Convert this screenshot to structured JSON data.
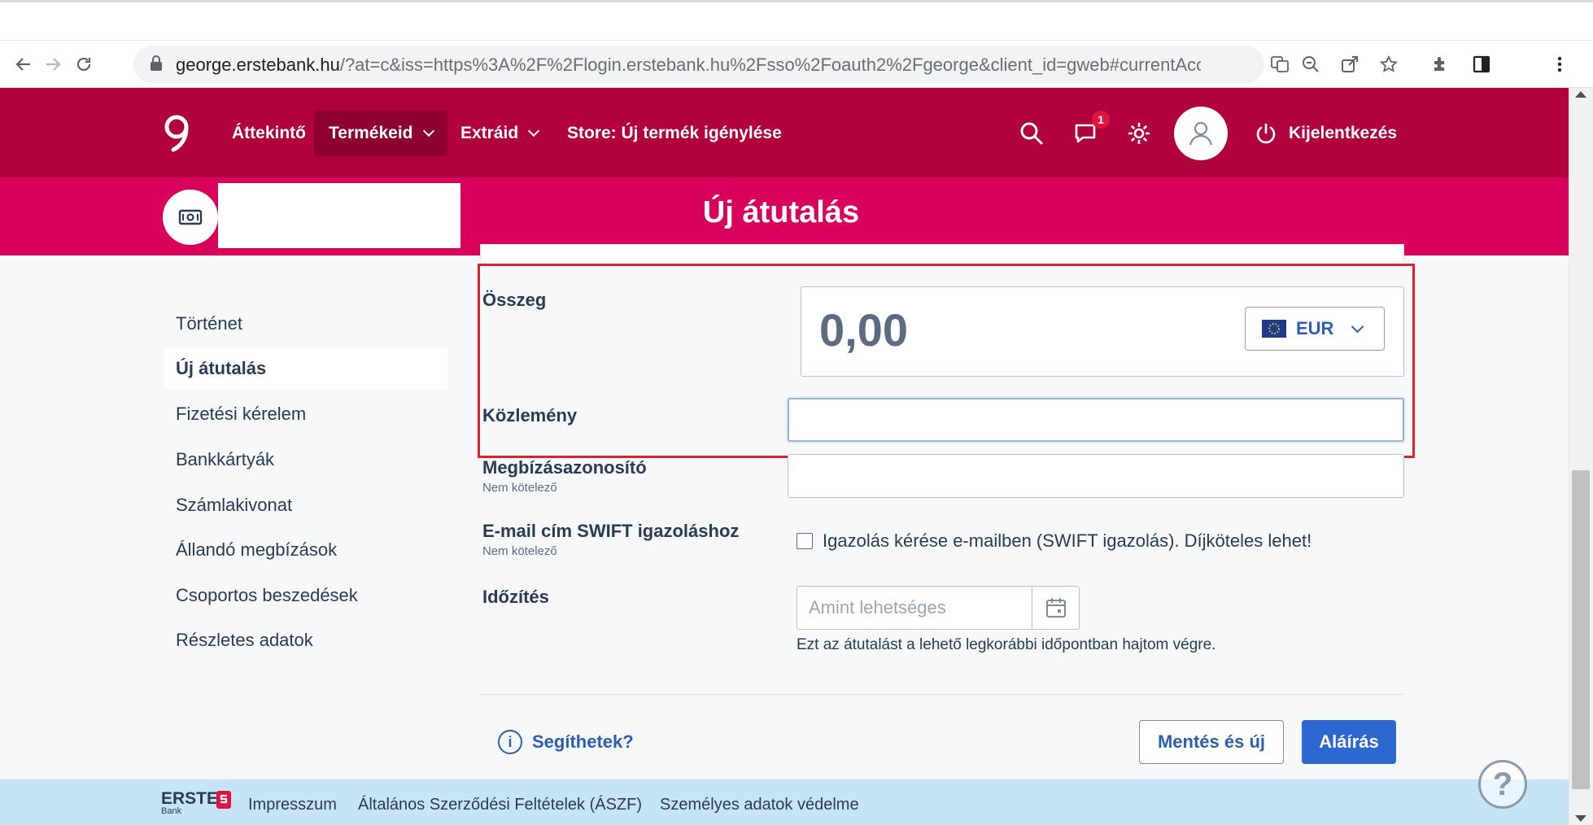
{
  "browser": {
    "url_host": "george.erstebank.hu",
    "url_rest": "/?at=c&iss=https%3A%2F%2Flogin.erstebank.hu%2Fsso%2Foauth2%2Fgeorge&client_id=gweb#currentAccount/fb45..."
  },
  "header": {
    "nav": [
      {
        "label": "Áttekintő"
      },
      {
        "label": "Termékeid"
      },
      {
        "label": "Extráid"
      },
      {
        "label": "Store: Új termék igénylése"
      }
    ],
    "messages_badge": "1",
    "logout_label": "Kijelentkezés"
  },
  "page": {
    "title": "Új átutalás"
  },
  "sidebar": {
    "items": [
      {
        "label": "Történet"
      },
      {
        "label": "Új átutalás"
      },
      {
        "label": "Fizetési kérelem"
      },
      {
        "label": "Bankkártyák"
      },
      {
        "label": "Számlakivonat"
      },
      {
        "label": "Állandó megbízások"
      },
      {
        "label": "Csoportos beszedések"
      },
      {
        "label": "Részletes adatok"
      }
    ]
  },
  "form": {
    "amount_label": "Összeg",
    "amount_value": "0,00",
    "currency": "EUR",
    "message_label": "Közlemény",
    "message_value": "",
    "reference_label": "Megbízásazonosító",
    "reference_sub": "Nem kötelező",
    "email_label": "E-mail cím SWIFT igazoláshoz",
    "email_sub": "Nem kötelező",
    "swift_checkbox_label": "Igazolás kérése e-mailben (SWIFT igazolás). Díjköteles lehet!",
    "timing_label": "Időzítés",
    "timing_placeholder": "Amint lehetséges",
    "timing_hint": "Ezt az átutalást a lehető legkorábbi időpontban hajtom végre."
  },
  "actions": {
    "help": "Segíthetek?",
    "save_new": "Mentés és új",
    "sign": "Aláírás"
  },
  "footer": {
    "brand": "ERSTE",
    "brand_sub": "Bank",
    "links": [
      {
        "label": "Impresszum"
      },
      {
        "label": "Általános Szerződési Feltételek (ÁSZF)"
      },
      {
        "label": "Személyes adatok védelme"
      }
    ],
    "help_fab": "?"
  },
  "colors": {
    "nav_bg": "#b0003e",
    "subheader_bg": "#d9005c",
    "primary_button": "#2c68d0",
    "highlight_border": "#e0202a",
    "footer_bg": "#c7e4f7"
  }
}
